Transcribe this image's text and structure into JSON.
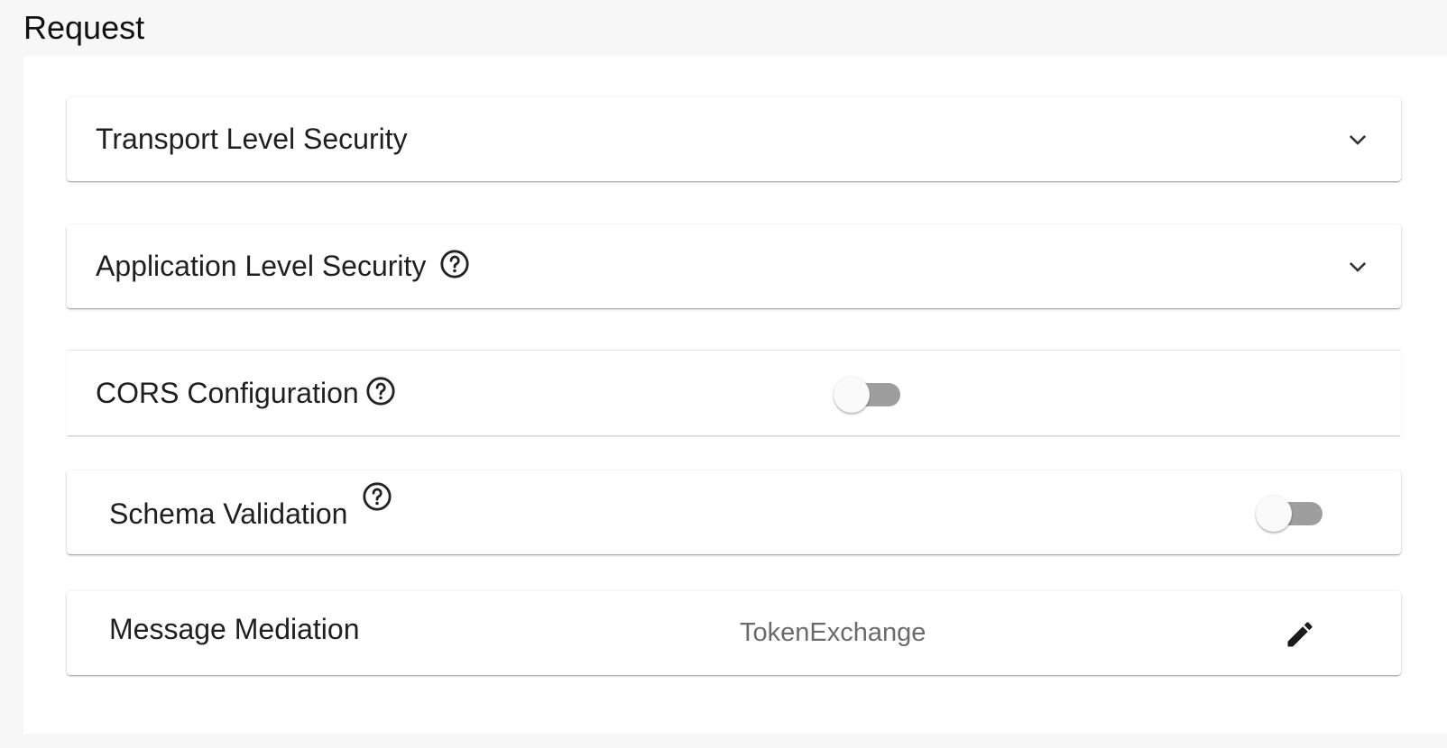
{
  "section": {
    "title": "Request"
  },
  "cards": {
    "transport": {
      "label": "Transport Level Security",
      "icon": "chevron-down-icon"
    },
    "application": {
      "label": "Application Level Security",
      "help_icon": "help-circle-icon",
      "icon": "chevron-down-icon"
    },
    "cors": {
      "label": "CORS Configuration",
      "help_icon": "help-circle-icon",
      "enabled": false
    },
    "schema": {
      "label": "Schema Validation",
      "help_icon": "help-circle-icon",
      "enabled": false
    },
    "mediation": {
      "label": "Message Mediation",
      "value": "TokenExchange",
      "icon": "pencil-edit-icon"
    }
  },
  "colors": {
    "page_background": "#f7f7f7",
    "panel_background": "#ffffff",
    "toggle_track_off": "#9e9e9e",
    "toggle_thumb": "#fafafa",
    "text_secondary": "#6b6b6b"
  }
}
